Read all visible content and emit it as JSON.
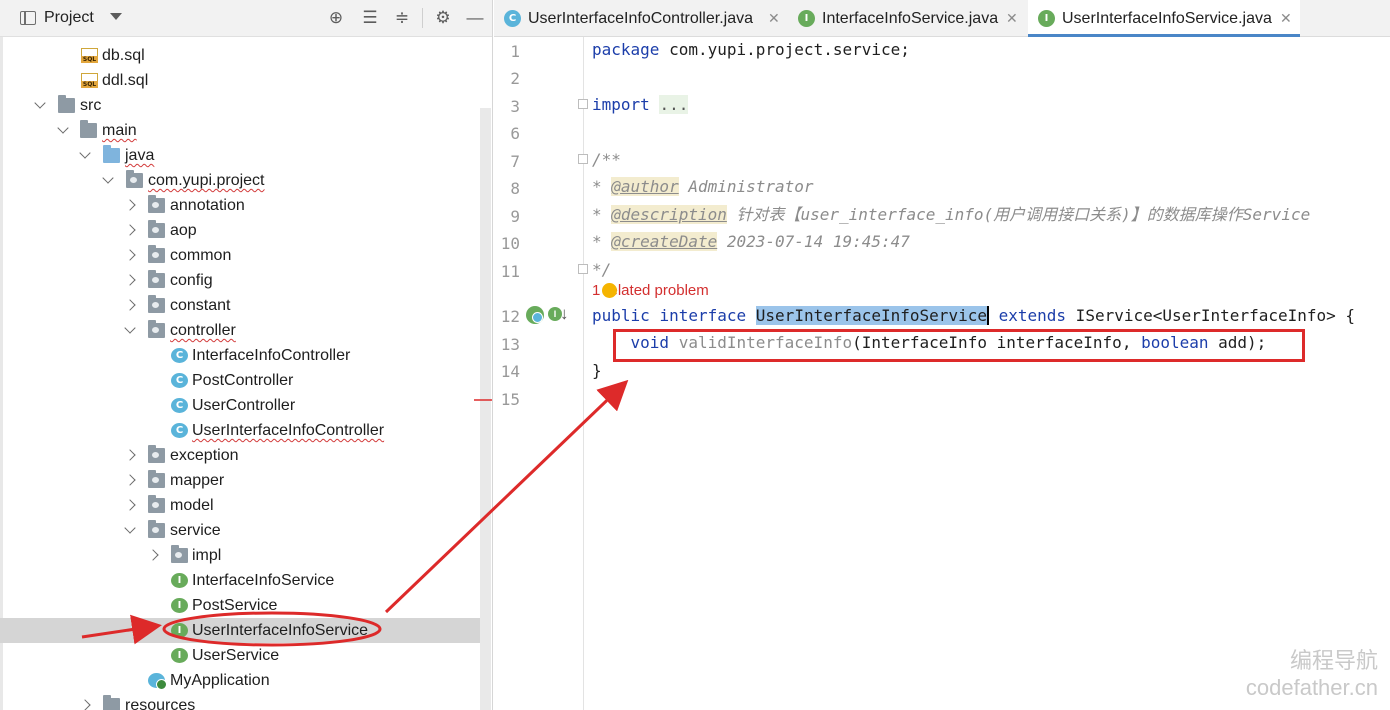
{
  "project_panel": {
    "title": "Project",
    "tree": [
      {
        "label": "db.sql",
        "icon": "sql-file-icon"
      },
      {
        "label": "ddl.sql",
        "icon": "sql-file-icon"
      },
      {
        "label": "src",
        "icon": "folder-icon",
        "expanded": true
      },
      {
        "label": "main",
        "icon": "folder-icon",
        "expanded": true
      },
      {
        "label": "java",
        "icon": "source-folder-icon",
        "expanded": true
      },
      {
        "label": "com.yupi.project",
        "icon": "package-icon",
        "expanded": true
      },
      {
        "label": "annotation",
        "icon": "package-icon"
      },
      {
        "label": "aop",
        "icon": "package-icon"
      },
      {
        "label": "common",
        "icon": "package-icon"
      },
      {
        "label": "config",
        "icon": "package-icon"
      },
      {
        "label": "constant",
        "icon": "package-icon"
      },
      {
        "label": "controller",
        "icon": "package-icon",
        "expanded": true
      },
      {
        "label": "InterfaceInfoController",
        "icon": "class-icon"
      },
      {
        "label": "PostController",
        "icon": "class-icon"
      },
      {
        "label": "UserController",
        "icon": "class-icon"
      },
      {
        "label": "UserInterfaceInfoController",
        "icon": "class-icon"
      },
      {
        "label": "exception",
        "icon": "package-icon"
      },
      {
        "label": "mapper",
        "icon": "package-icon"
      },
      {
        "label": "model",
        "icon": "package-icon"
      },
      {
        "label": "service",
        "icon": "package-icon",
        "expanded": true
      },
      {
        "label": "impl",
        "icon": "package-icon"
      },
      {
        "label": "InterfaceInfoService",
        "icon": "interface-icon"
      },
      {
        "label": "PostService",
        "icon": "interface-icon"
      },
      {
        "label": "UserInterfaceInfoService",
        "icon": "interface-icon",
        "selected": true
      },
      {
        "label": "UserService",
        "icon": "interface-icon"
      },
      {
        "label": "MyApplication",
        "icon": "spring-app-icon"
      },
      {
        "label": "resources",
        "icon": "folder-icon"
      }
    ]
  },
  "tabs": [
    {
      "label": "UserInterfaceInfoController.java",
      "icon": "C",
      "active": false
    },
    {
      "label": "InterfaceInfoService.java",
      "icon": "I",
      "active": false
    },
    {
      "label": "UserInterfaceInfoService.java",
      "icon": "I",
      "active": true
    }
  ],
  "editor": {
    "line_numbers": [
      "1",
      "2",
      "3",
      "6",
      "7",
      "8",
      "9",
      "10",
      "11",
      "12",
      "13",
      "14",
      "15"
    ],
    "code": {
      "l1_kw": "package",
      "l1_rest": " com.yupi.project.service;",
      "l3_kw": "import",
      "l3_fold": "...",
      "l7": "/**",
      "l8_star": "* ",
      "l8_tag": "@author",
      "l8_rest": " Administrator",
      "l9_star": "* ",
      "l9_tag": "@description",
      "l9_rest": " 针对表【user_interface_info(用户调用接口关系)】的数据库操作Service",
      "l10_star": "* ",
      "l10_tag": "@createDate",
      "l10_rest": " 2023-07-14 19:45:47",
      "l11": "*/",
      "problem": "1 related problem",
      "l12_kw1": "public",
      "l12_kw2": "interface",
      "l12_name": "UserInterfaceInfoService",
      "l12_kw3": "extends",
      "l12_rest": " IService<UserInterfaceInfo> {",
      "l13_kw1": "void",
      "l13_method": " validInterfaceInfo",
      "l13_args1": "(InterfaceInfo interfaceInfo, ",
      "l13_kw2": "boolean",
      "l13_args2": " add);",
      "l14": "}"
    }
  },
  "watermark": {
    "line1": "编程导航",
    "line2": "codefather.cn"
  },
  "colors": {
    "annotation_red": "#dd2a2a",
    "selection_blue": "#9bc4ea",
    "keyword_blue": "#1c3eaa"
  }
}
